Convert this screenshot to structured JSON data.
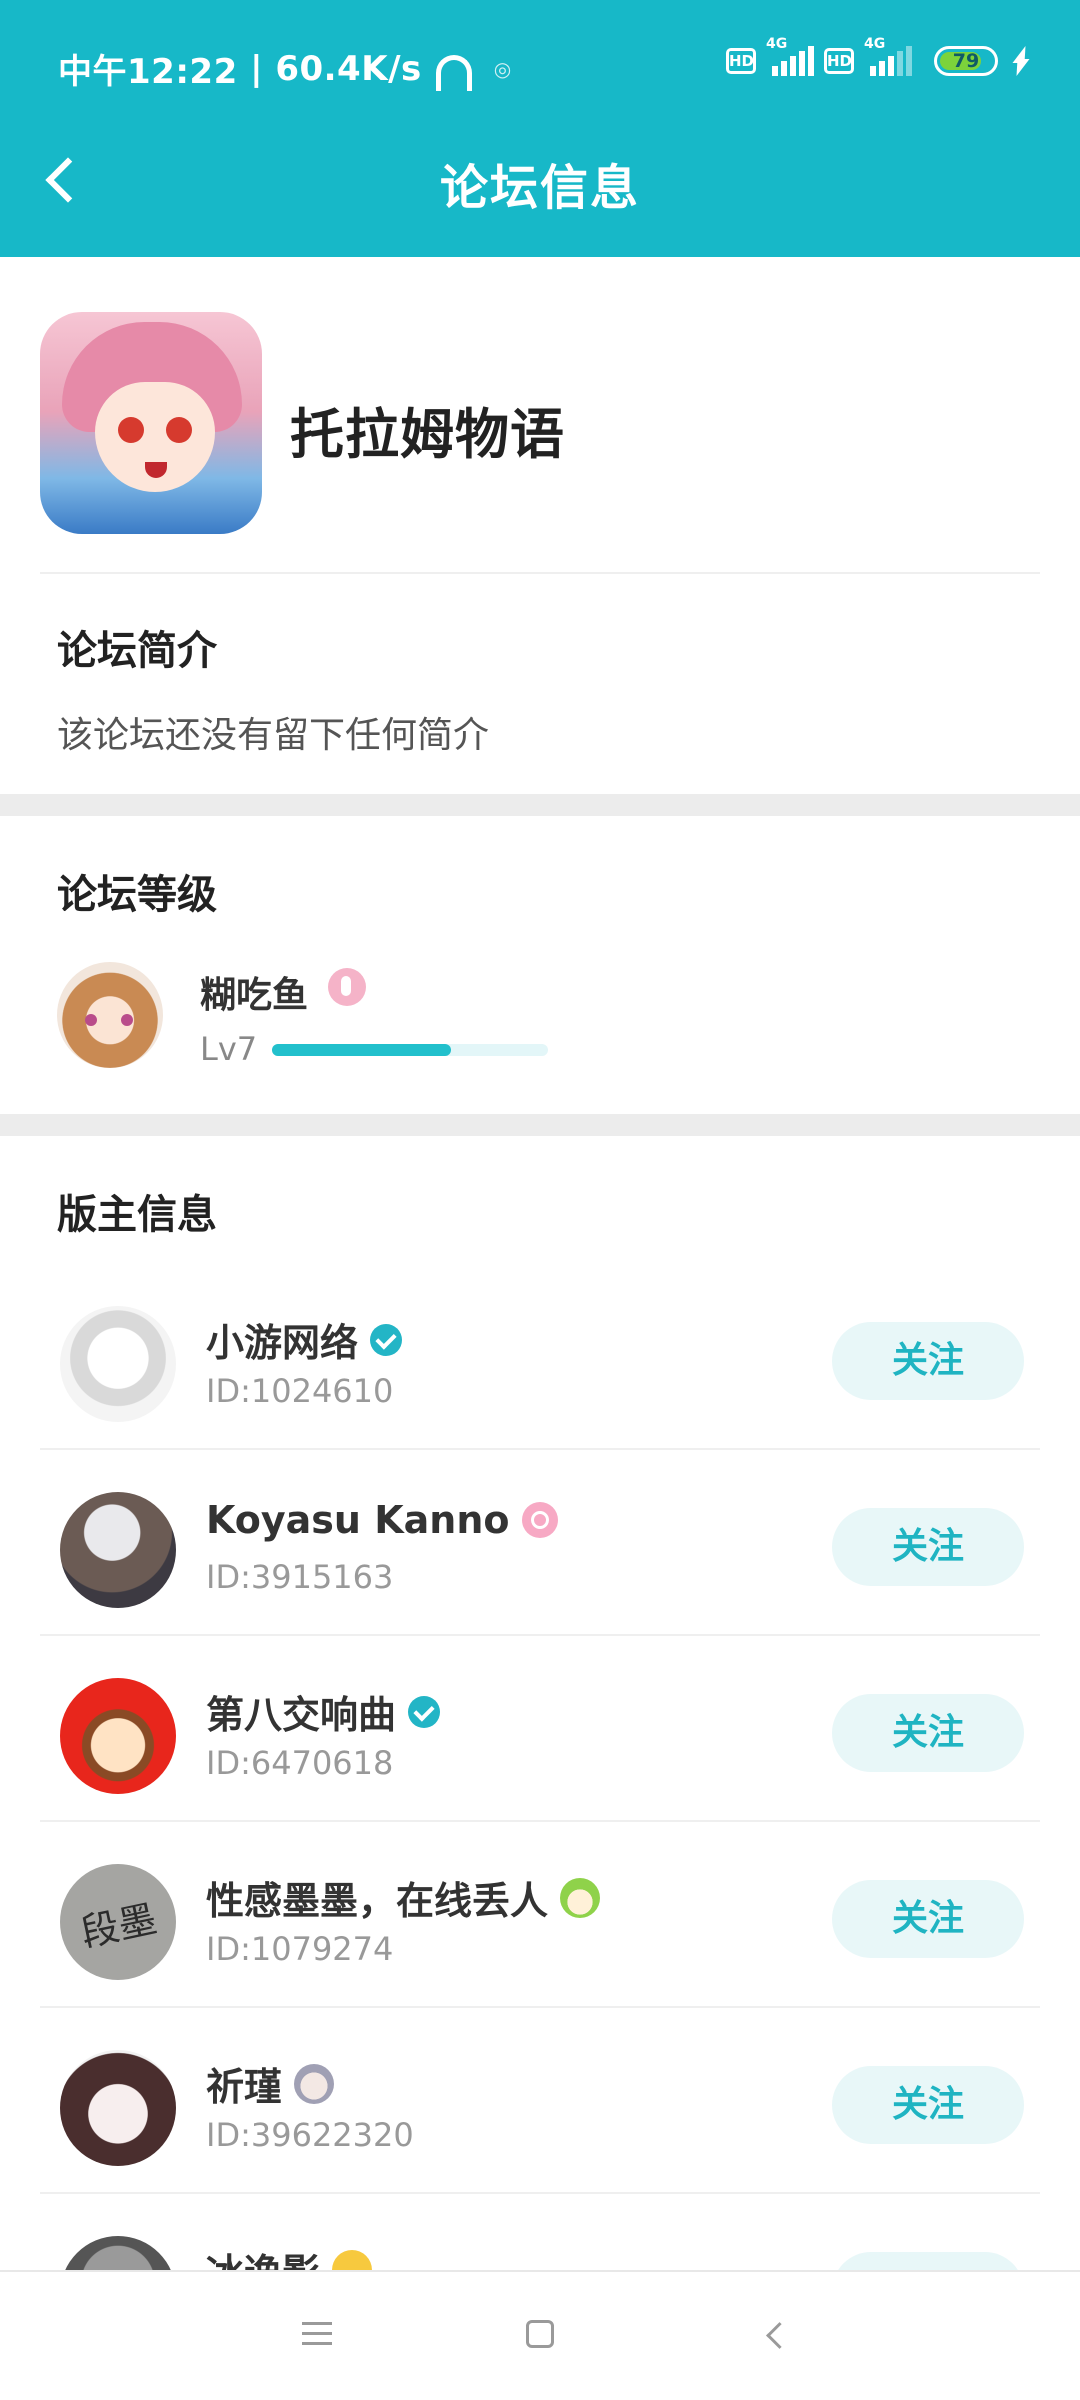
{
  "status_bar": {
    "time": "中午12:22",
    "net_speed": "60.4K/s",
    "hd1": "HD",
    "sig1": "4G",
    "hd2": "HD",
    "sig2": "4G",
    "battery": "79",
    "battery_level": 0.79
  },
  "header": {
    "title": "论坛信息"
  },
  "forum": {
    "name": "托拉姆物语"
  },
  "intro": {
    "title": "论坛简介",
    "text": "该论坛还没有留下任何简介"
  },
  "level": {
    "title": "论坛等级",
    "user": "糊吃鱼",
    "level_label": "Lv7",
    "progress": 0.65
  },
  "moderators": {
    "title": "版主信息",
    "follow_label": "关注",
    "items": [
      {
        "name": "小游网络",
        "id": "ID:1024610"
      },
      {
        "name": "Koyasu Kanno",
        "id": "ID:3915163"
      },
      {
        "name": "第八交响曲",
        "id": "ID:6470618"
      },
      {
        "name": "性感墨墨，在线丢人",
        "id": "ID:1079274"
      },
      {
        "name": "祈瑾",
        "id": "ID:39622320"
      },
      {
        "name": "冰逸影",
        "id": ""
      }
    ],
    "avatar_text_4": "段墨"
  },
  "colors": {
    "accent": "#17b8c8",
    "follow_bg": "#e8f7f8",
    "follow_text": "#1fb4c2",
    "progress": "#22c0cc"
  }
}
